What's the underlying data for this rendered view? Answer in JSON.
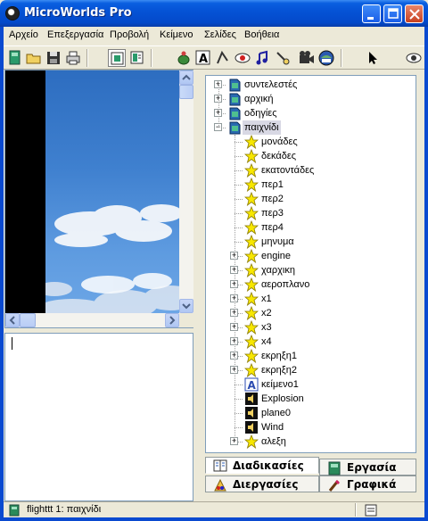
{
  "window": {
    "title": "MicroWorlds Pro"
  },
  "menu": [
    "Αρχείο",
    "Επεξεργασία",
    "Προβολή",
    "Κείμενο",
    "Σελίδες",
    "Βοήθεια"
  ],
  "toolbar": {
    "icons": [
      "new-page-icon",
      "open-folder-icon",
      "save-icon",
      "print-icon",
      "view-project-icon",
      "view-card-icon",
      "turtle-icon",
      "text-box-icon",
      "shapes-icon",
      "button-tool-icon",
      "music-icon",
      "slider-tool-icon",
      "video-icon",
      "painting-icon",
      "pointer-icon",
      "eye-icon"
    ]
  },
  "tree": {
    "nodes": [
      {
        "label": "συντελεστές",
        "type": "page",
        "expander": "+",
        "level": 0
      },
      {
        "label": "αρχική",
        "type": "page",
        "expander": "+",
        "level": 0
      },
      {
        "label": "οδηγίες",
        "type": "page",
        "expander": "+",
        "level": 0
      },
      {
        "label": "παιχνίδι",
        "type": "page",
        "expander": "-",
        "level": 0,
        "selected": true
      },
      {
        "label": "μονάδες",
        "type": "star",
        "expander": "",
        "level": 1
      },
      {
        "label": "δεκάδες",
        "type": "star",
        "expander": "",
        "level": 1
      },
      {
        "label": "εκατοντάδες",
        "type": "star",
        "expander": "",
        "level": 1
      },
      {
        "label": "περ1",
        "type": "star",
        "expander": "",
        "level": 1
      },
      {
        "label": "περ2",
        "type": "star",
        "expander": "",
        "level": 1
      },
      {
        "label": "περ3",
        "type": "star",
        "expander": "",
        "level": 1
      },
      {
        "label": "περ4",
        "type": "star",
        "expander": "",
        "level": 1
      },
      {
        "label": "μηνυμα",
        "type": "star",
        "expander": "",
        "level": 1
      },
      {
        "label": "engine",
        "type": "star",
        "expander": "+",
        "level": 1
      },
      {
        "label": "χαρχικη",
        "type": "star",
        "expander": "+",
        "level": 1
      },
      {
        "label": "αεροπλανο",
        "type": "star",
        "expander": "+",
        "level": 1
      },
      {
        "label": "x1",
        "type": "star",
        "expander": "+",
        "level": 1
      },
      {
        "label": "x2",
        "type": "star",
        "expander": "+",
        "level": 1
      },
      {
        "label": "x3",
        "type": "star",
        "expander": "+",
        "level": 1
      },
      {
        "label": "x4",
        "type": "star",
        "expander": "+",
        "level": 1
      },
      {
        "label": "εκρηξη1",
        "type": "star",
        "expander": "+",
        "level": 1
      },
      {
        "label": "εκρηξη2",
        "type": "star",
        "expander": "+",
        "level": 1
      },
      {
        "label": "κείμενο1",
        "type": "text",
        "expander": "",
        "level": 1
      },
      {
        "label": "Explosion",
        "type": "sound",
        "expander": "",
        "level": 1
      },
      {
        "label": "plane0",
        "type": "sound",
        "expander": "",
        "level": 1
      },
      {
        "label": "Wind",
        "type": "sound",
        "expander": "",
        "level": 1
      },
      {
        "label": "αλεξη",
        "type": "star",
        "expander": "+",
        "level": 1
      }
    ]
  },
  "tabs": {
    "procedures": "Διαδικασίες",
    "project": "Εργασία",
    "processes": "Διεργασίες",
    "graphics": "Γραφικά"
  },
  "status": {
    "text": "flighttt 1:  παιχνίδι"
  }
}
